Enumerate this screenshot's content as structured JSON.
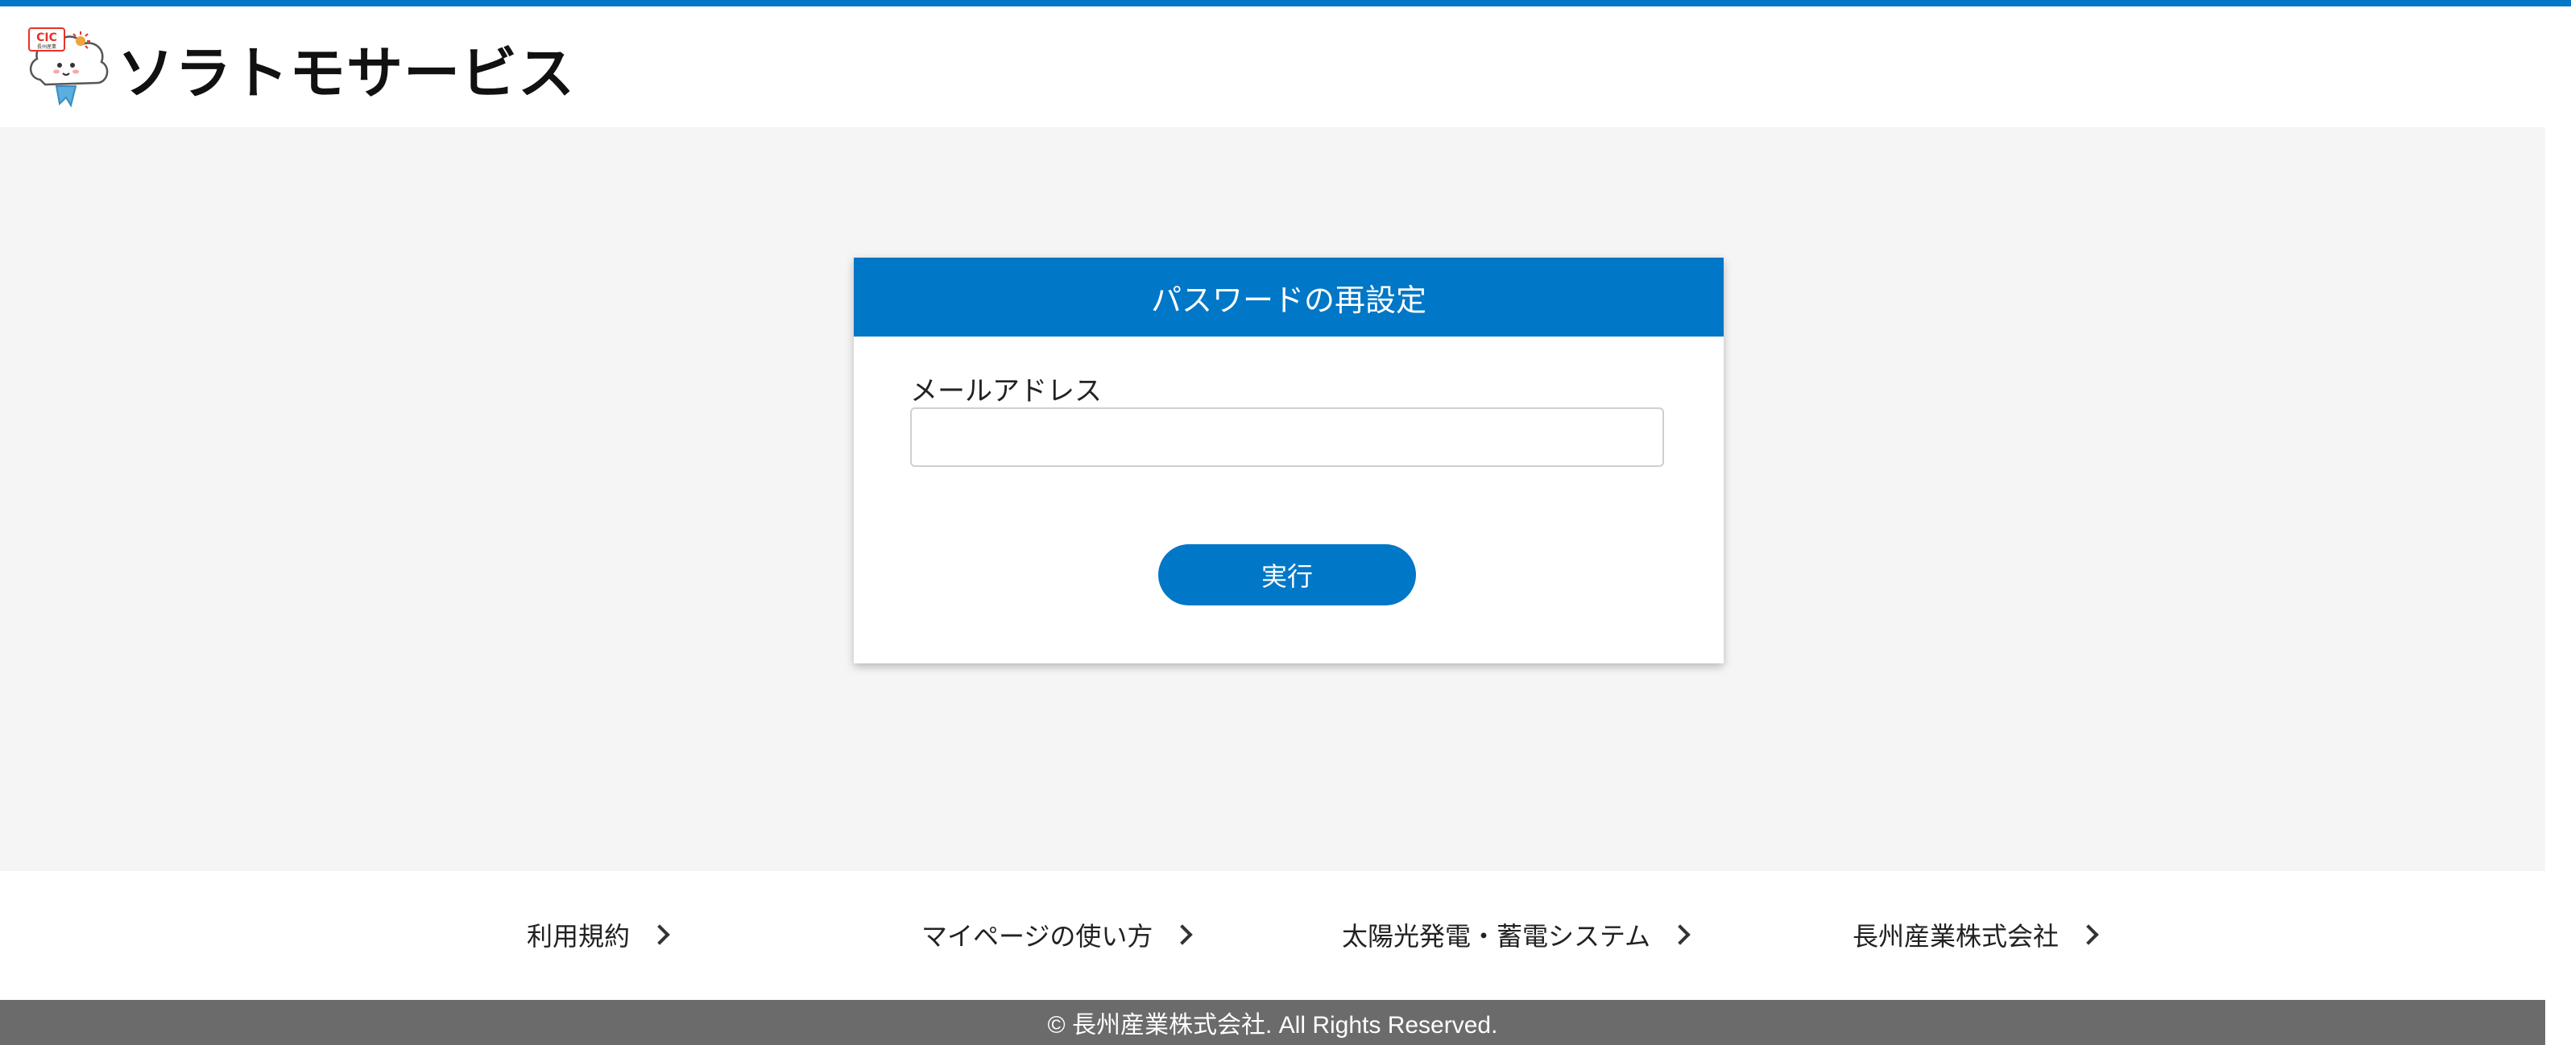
{
  "header": {
    "brand": "ソラトモサービス",
    "logo_badge": "CIC",
    "logo_badge_sub": "長州産業"
  },
  "reset_form": {
    "title": "パスワードの再設定",
    "email_label": "メールアドレス",
    "email_value": "",
    "email_placeholder": "",
    "submit_label": "実行"
  },
  "footer": {
    "links": [
      {
        "label": "利用規約"
      },
      {
        "label": "マイページの使い方"
      },
      {
        "label": "太陽光発電・蓄電システム"
      },
      {
        "label": "長州産業株式会社"
      }
    ],
    "copyright": "© 長州産業株式会社. All Rights Reserved."
  },
  "colors": {
    "accent": "#0077c7",
    "background": "#f5f5f5",
    "footer_bar": "#6b6b6b"
  },
  "icons": {
    "logo": "mascot-cloud-icon",
    "link_arrow": "chevron-right-icon"
  }
}
